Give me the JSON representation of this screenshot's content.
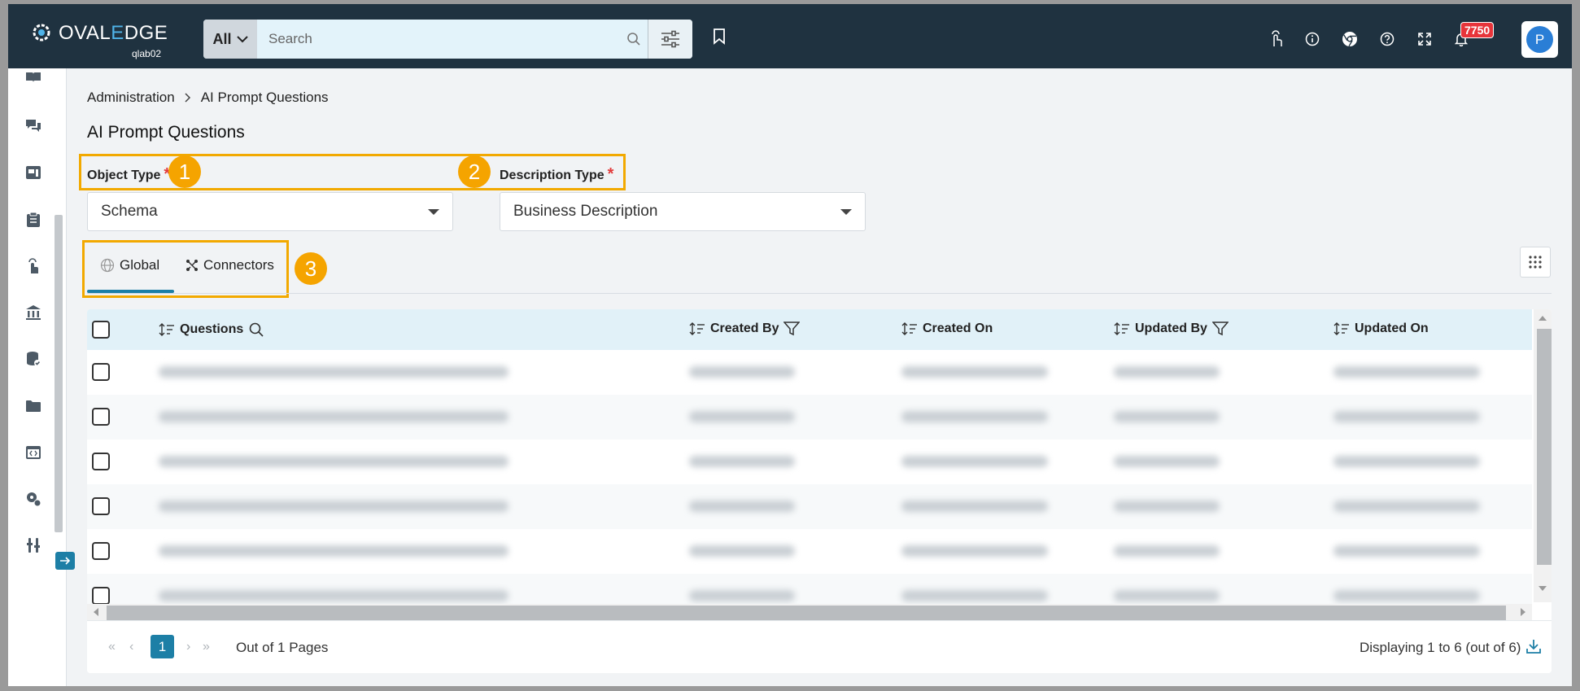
{
  "header": {
    "brand_prefix": "OVAL",
    "brand_e": "E",
    "brand_suffix": "DGE",
    "instance": "qlab02",
    "search_scope": "All",
    "search_placeholder": "Search",
    "notification_count": "7750",
    "user_initial": "P",
    "icons": [
      "hand-pointer-icon",
      "info-icon",
      "chrome-icon",
      "help-icon",
      "expand-icon",
      "bell-icon"
    ]
  },
  "breadcrumb": {
    "root": "Administration",
    "current": "AI Prompt Questions"
  },
  "page": {
    "title": "AI Prompt Questions"
  },
  "filters": {
    "object_type_label": "Object Type",
    "object_type_value": "Schema",
    "description_type_label": "Description Type",
    "description_type_value": "Business Description",
    "required_mark": "*"
  },
  "callouts": [
    "1",
    "2",
    "3"
  ],
  "tabs": [
    {
      "label": "Global",
      "active": true
    },
    {
      "label": "Connectors",
      "active": false
    }
  ],
  "table": {
    "columns": [
      "Questions",
      "Created By",
      "Created On",
      "Updated By",
      "Updated On"
    ],
    "row_count_visible": 6
  },
  "pagination": {
    "current_page": "1",
    "pages_text": "Out of 1 Pages",
    "display_text": "Displaying 1 to 6 (out of 6)"
  },
  "colors": {
    "topbar": "#1f3240",
    "accent": "#1d7fa6",
    "highlight": "#f2a900",
    "badge": "#e8343a"
  }
}
